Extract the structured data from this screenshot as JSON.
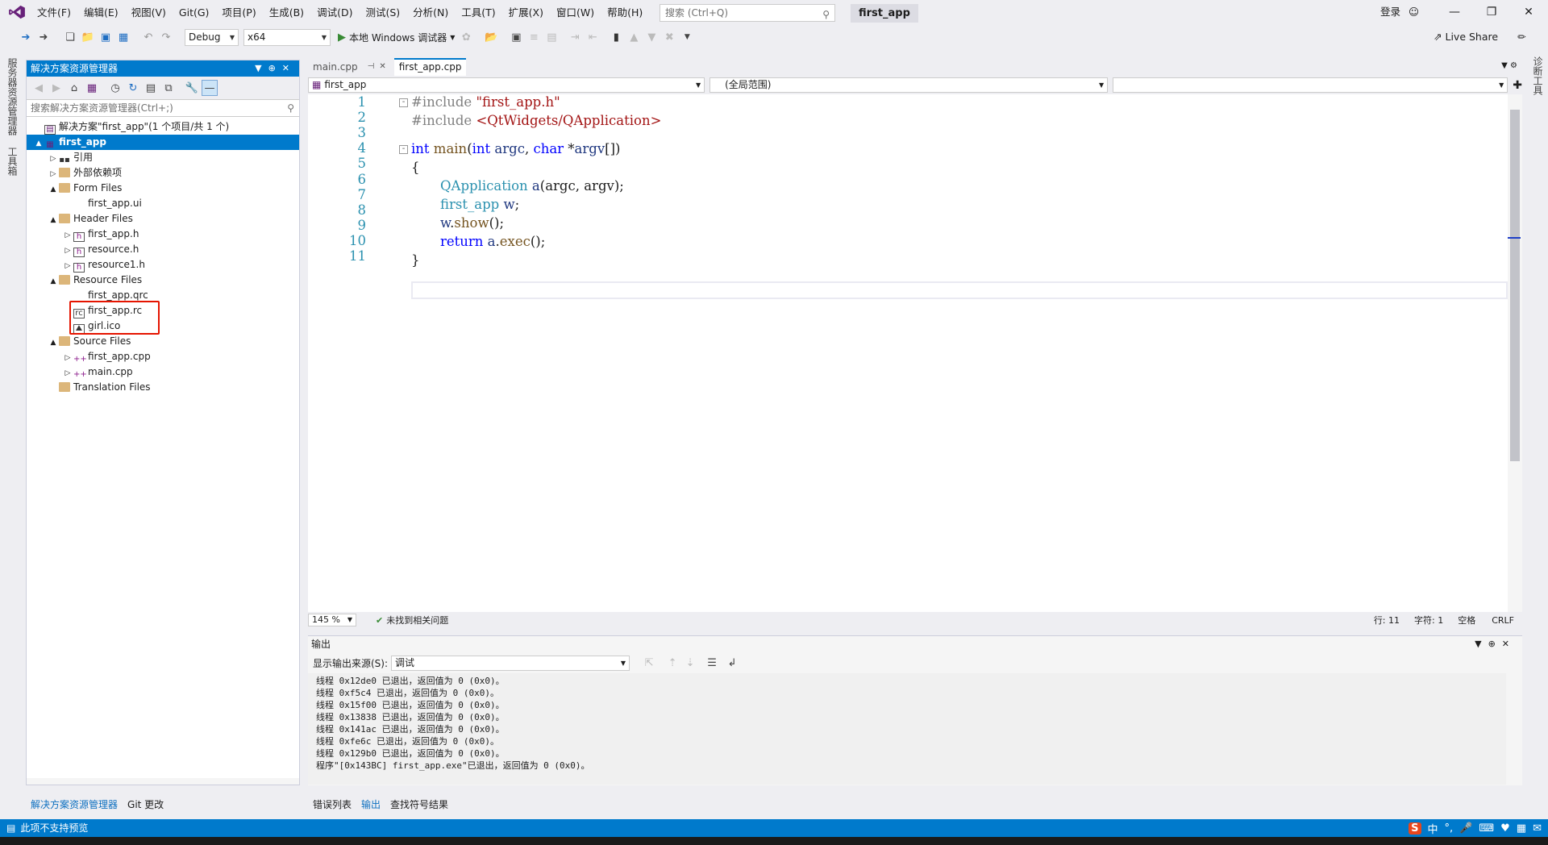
{
  "menu": [
    "文件(F)",
    "编辑(E)",
    "视图(V)",
    "Git(G)",
    "项目(P)",
    "生成(B)",
    "调试(D)",
    "测试(S)",
    "分析(N)",
    "工具(T)",
    "扩展(X)",
    "窗口(W)",
    "帮助(H)"
  ],
  "search": {
    "placeholder": "搜索 (Ctrl+Q)"
  },
  "title": "first_app",
  "signin": "登录",
  "toolbar": {
    "config": "Debug",
    "platform": "x64",
    "run_label": "本地 Windows 调试器",
    "live_share": "Live Share"
  },
  "left_strip": {
    "tab1": "服务器资源管理器",
    "tab2": "工具箱"
  },
  "right_strip": {
    "tab1": "诊断工具"
  },
  "solution_explorer": {
    "title": "解决方案资源管理器",
    "search_placeholder": "搜索解决方案资源管理器(Ctrl+;)",
    "tree": [
      {
        "label": "解决方案\"first_app\"(1 个项目/共 1 个)",
        "indent": 0,
        "expander": "",
        "icon": "solution-icon"
      },
      {
        "label": "first_app",
        "indent": 0,
        "expander": "▲",
        "icon": "project-icon",
        "selected": true
      },
      {
        "label": "引用",
        "indent": 1,
        "expander": "▷",
        "icon": "references-icon"
      },
      {
        "label": "外部依赖项",
        "indent": 1,
        "expander": "▷",
        "icon": "folder-icon"
      },
      {
        "label": "Form Files",
        "indent": 1,
        "expander": "▲",
        "icon": "folder-icon"
      },
      {
        "label": "first_app.ui",
        "indent": 2,
        "expander": "",
        "icon": ""
      },
      {
        "label": "Header Files",
        "indent": 1,
        "expander": "▲",
        "icon": "folder-icon"
      },
      {
        "label": "first_app.h",
        "indent": 2,
        "expander": "▷",
        "icon": "header-file-icon"
      },
      {
        "label": "resource.h",
        "indent": 2,
        "expander": "▷",
        "icon": "header-file-icon"
      },
      {
        "label": "resource1.h",
        "indent": 2,
        "expander": "▷",
        "icon": "header-file-icon"
      },
      {
        "label": "Resource Files",
        "indent": 1,
        "expander": "▲",
        "icon": "folder-icon"
      },
      {
        "label": "first_app.qrc",
        "indent": 2,
        "expander": "",
        "icon": ""
      },
      {
        "label": "first_app.rc",
        "indent": 2,
        "expander": "",
        "icon": "rc-file-icon"
      },
      {
        "label": "girl.ico",
        "indent": 2,
        "expander": "",
        "icon": "image-file-icon"
      },
      {
        "label": "Source Files",
        "indent": 1,
        "expander": "▲",
        "icon": "folder-icon"
      },
      {
        "label": "first_app.cpp",
        "indent": 2,
        "expander": "▷",
        "icon": "cpp-file-icon"
      },
      {
        "label": "main.cpp",
        "indent": 2,
        "expander": "▷",
        "icon": "cpp-file-icon"
      },
      {
        "label": "Translation Files",
        "indent": 1,
        "expander": "",
        "icon": "folder-icon"
      }
    ],
    "bottom_tabs": [
      "解决方案资源管理器",
      "Git 更改"
    ]
  },
  "editor": {
    "tabs": [
      {
        "label": "main.cpp",
        "pin": "⊣",
        "close": "✕",
        "active": false
      },
      {
        "label": "first_app.cpp",
        "active": true
      }
    ],
    "nav_project": "first_app",
    "nav_scope": "(全局范围)",
    "line_numbers": [
      "1",
      "2",
      "3",
      "4",
      "5",
      "6",
      "7",
      "8",
      "9",
      "10",
      "11"
    ],
    "code": {
      "l1_pp": "#include ",
      "l1_str": "\"first_app.h\"",
      "l2_pp": "#include ",
      "l2_str": "<QtWidgets/QApplication>",
      "l4_kw1": "int",
      "l4_fn": " main",
      "l4_p1": "(",
      "l4_kw2": "int",
      "l4_v1": " argc",
      "l4_p2": ", ",
      "l4_kw3": "char",
      "l4_p3": " *",
      "l4_v2": "argv",
      "l4_p4": "[])",
      "l5": "{",
      "l6_ty": "QApplication",
      "l6_v": " a",
      "l6_rest": "(argc, argv);",
      "l7_ty": "first_app",
      "l7_v": " w",
      "l7_rest": ";",
      "l8_v": "w",
      "l8_p": ".",
      "l8_fn": "show",
      "l8_rest": "();",
      "l9_kw": "return",
      "l9_v": " a",
      "l9_p": ".",
      "l9_fn": "exec",
      "l9_rest": "();",
      "l10": "}"
    },
    "status": {
      "zoom": "145 %",
      "issues": "未找到相关问题",
      "line": "行: 11",
      "char": "字符: 1",
      "ws": "空格",
      "eol": "CRLF"
    }
  },
  "output": {
    "title": "输出",
    "source_label": "显示输出来源(S):",
    "source_value": "调试",
    "lines": [
      "线程 0x12de0 已退出，返回值为 0 (0x0)。",
      "线程 0xf5c4 已退出，返回值为 0 (0x0)。",
      "线程 0x15f00 已退出，返回值为 0 (0x0)。",
      "线程 0x13838 已退出，返回值为 0 (0x0)。",
      "线程 0x141ac 已退出，返回值为 0 (0x0)。",
      "线程 0xfe6c 已退出，返回值为 0 (0x0)。",
      "线程 0x129b0 已退出，返回值为 0 (0x0)。",
      "程序\"[0x143BC] first_app.exe\"已退出，返回值为 0 (0x0)。"
    ],
    "bottom_tabs": [
      "错误列表",
      "输出",
      "查找符号结果"
    ]
  },
  "statusbar": {
    "text": "此项不支持预览"
  },
  "tray": {
    "ime": "中",
    "ime_logo": "S"
  },
  "colors": {
    "accent": "#007acc",
    "keyword": "#0000ff",
    "string": "#a31515",
    "type": "#2b91af",
    "highlight_box": "#e51400"
  }
}
